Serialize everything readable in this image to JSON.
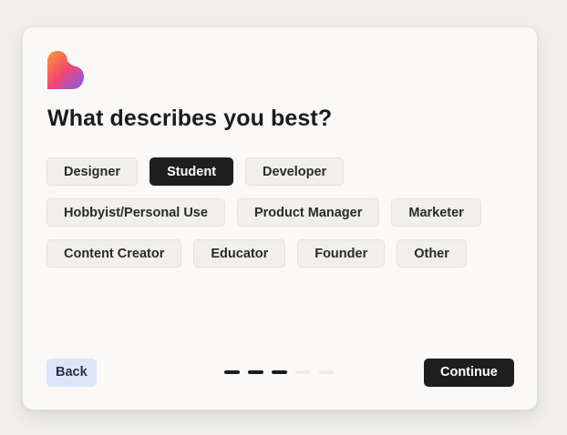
{
  "logo": {
    "icon": "heart-logo-icon",
    "gradient_colors": [
      "#ff8a3d",
      "#f04a7a",
      "#7b5cf5"
    ]
  },
  "title": "What describes you best?",
  "options": [
    [
      {
        "label": "Designer",
        "selected": false
      },
      {
        "label": "Student",
        "selected": true
      },
      {
        "label": "Developer",
        "selected": false
      }
    ],
    [
      {
        "label": "Hobbyist/Personal Use",
        "selected": false
      },
      {
        "label": "Product Manager",
        "selected": false
      },
      {
        "label": "Marketer",
        "selected": false
      }
    ],
    [
      {
        "label": "Content Creator",
        "selected": false
      },
      {
        "label": "Educator",
        "selected": false
      },
      {
        "label": "Founder",
        "selected": false
      },
      {
        "label": "Other",
        "selected": false
      }
    ]
  ],
  "footer": {
    "back_label": "Back",
    "continue_label": "Continue",
    "progress": {
      "current_step": 3,
      "total_steps": 5
    }
  },
  "colors": {
    "selected_chip": "#1e1e1e",
    "chip": "#f1efea",
    "back_button": "#dce6f8",
    "card": "#faf9f7"
  }
}
